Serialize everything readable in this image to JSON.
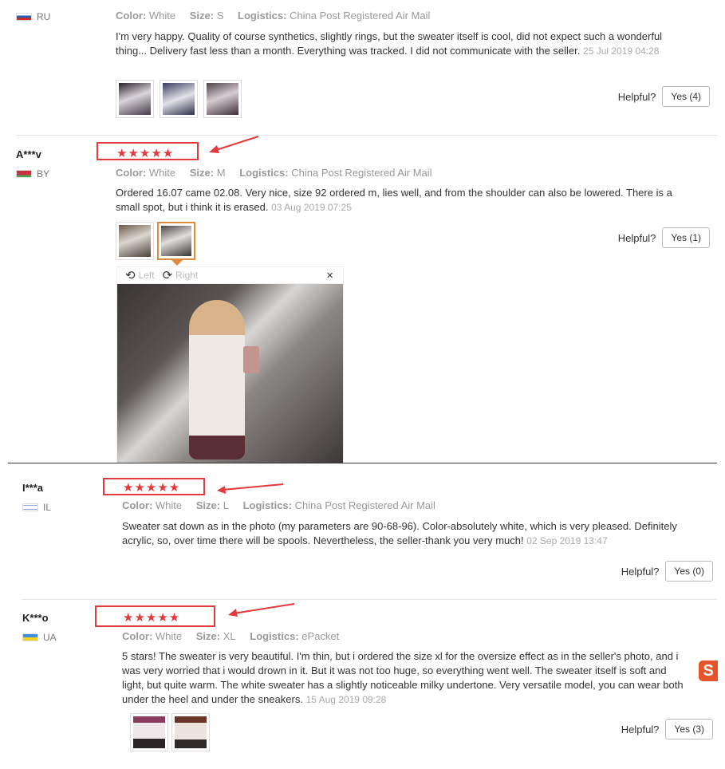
{
  "reviews": [
    {
      "name": "",
      "country": "RU",
      "color_label": "Color:",
      "color": "White",
      "size_label": "Size:",
      "size": "S",
      "logistics_label": "Logistics:",
      "logistics": "China Post Registered Air Mail",
      "text": "I'm very happy. Quality of course synthetics, slightly rings, but the sweater itself is cool, did not expect such a wonderful thing... Delivery fast less than a month. Everything was tracked. I did not communicate with the seller.",
      "date": "25 Jul 2019 04:28",
      "helpful_label": "Helpful?",
      "yes_label": "Yes (4)"
    },
    {
      "name": "A***v",
      "country": "BY",
      "stars": "★★★★★",
      "color_label": "Color:",
      "color": "White",
      "size_label": "Size:",
      "size": "M",
      "logistics_label": "Logistics:",
      "logistics": "China Post Registered Air Mail",
      "text": "Ordered 16.07 came 02.08. Very nice, size 92 ordered m, lies well, and from the shoulder can also be lowered. There is a small spot, but i think it is erased.",
      "date": "03 Aug 2019 07:25",
      "helpful_label": "Helpful?",
      "yes_label": "Yes (1)",
      "viewer": {
        "left": "Left",
        "right": "Right",
        "close": "×"
      }
    },
    {
      "name": "I***a",
      "country": "IL",
      "stars": "★★★★★",
      "color_label": "Color:",
      "color": "White",
      "size_label": "Size:",
      "size": "L",
      "logistics_label": "Logistics:",
      "logistics": "China Post Registered Air Mail",
      "text": "Sweater sat down as in the photo (my parameters are 90-68-96). Color-absolutely white, which is very pleased. Definitely acrylic, so, over time there will be spools. Nevertheless, the seller-thank you very much!",
      "date": "02 Sep 2019 13:47",
      "helpful_label": "Helpful?",
      "yes_label": "Yes (0)"
    },
    {
      "name": "K***o",
      "country": "UA",
      "stars": "★★★★★",
      "color_label": "Color:",
      "color": "White",
      "size_label": "Size:",
      "size": "XL",
      "logistics_label": "Logistics:",
      "logistics": "ePacket",
      "text": "5 stars! The sweater is very beautiful. I'm thin, but i ordered the size xl for the oversize effect as in the seller's photo, and i was very worried that i would drown in it. But it was not too huge, so everything went well. The sweater itself is soft and light, but quite warm. The white sweater has a slightly noticeable milky undertone. Very versatile model, you can wear both under the heel and under the sneakers.",
      "date": "15 Aug 2019 09:28",
      "helpful_label": "Helpful?",
      "yes_label": "Yes (3)"
    }
  ],
  "colors": {
    "accent_red": "#e4393c",
    "thumb_active": "#e08a3c"
  }
}
